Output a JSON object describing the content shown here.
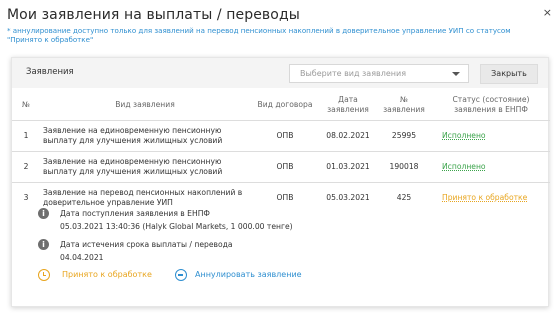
{
  "modal": {
    "title": "Мои заявления на выплаты / переводы",
    "close_glyph": "×",
    "note": "* аннулирование доступно только для заявлений на перевод пенсионных накоплений в доверительное управление УИП со статусом \"Принято к обработке\""
  },
  "panel": {
    "header_label": "Заявления",
    "select_placeholder": "Выберите вид заявления",
    "close_button": "Закрыть"
  },
  "table": {
    "columns": [
      "№",
      "Вид заявления",
      "Вид договора",
      "Дата заявления",
      "№ заявления",
      "Статус (состояние) заявления в ЕНПФ"
    ],
    "rows": [
      {
        "num": "1",
        "type": "Заявление на единовременную пенсионную выплату для улучшения жилищных условий",
        "contract": "ОПВ",
        "date": "08.02.2021",
        "app_no": "25995",
        "status": "Исполнено",
        "status_color": "#3aa34a"
      },
      {
        "num": "2",
        "type": "Заявление на единовременную пенсионную выплату для улучшения жилищных условий",
        "contract": "ОПВ",
        "date": "01.03.2021",
        "app_no": "190018",
        "status": "Исполнено",
        "status_color": "#3aa34a"
      },
      {
        "num": "3",
        "type": "Заявление на перевод пенсионных накоплений в доверительное управление УИП",
        "contract": "ОПВ",
        "date": "05.03.2021",
        "app_no": "425",
        "status": "Принято к обработке",
        "status_color": "#e8a51e"
      }
    ]
  },
  "details": {
    "receipt_label": "Дата поступления заявления в ЕНПФ",
    "receipt_value": "05.03.2021 13:40:36 (Halyk Global Markets, 1 000.00 тенге)",
    "expiry_label": "Дата истечения срока выплаты / перевода",
    "expiry_value": "04.04.2021",
    "status_text": "Принято к обработке",
    "cancel_link": "Аннулировать заявление"
  },
  "icons": {
    "info": "info-icon",
    "clock": "clock-icon",
    "cancel": "minus-circle-icon"
  }
}
